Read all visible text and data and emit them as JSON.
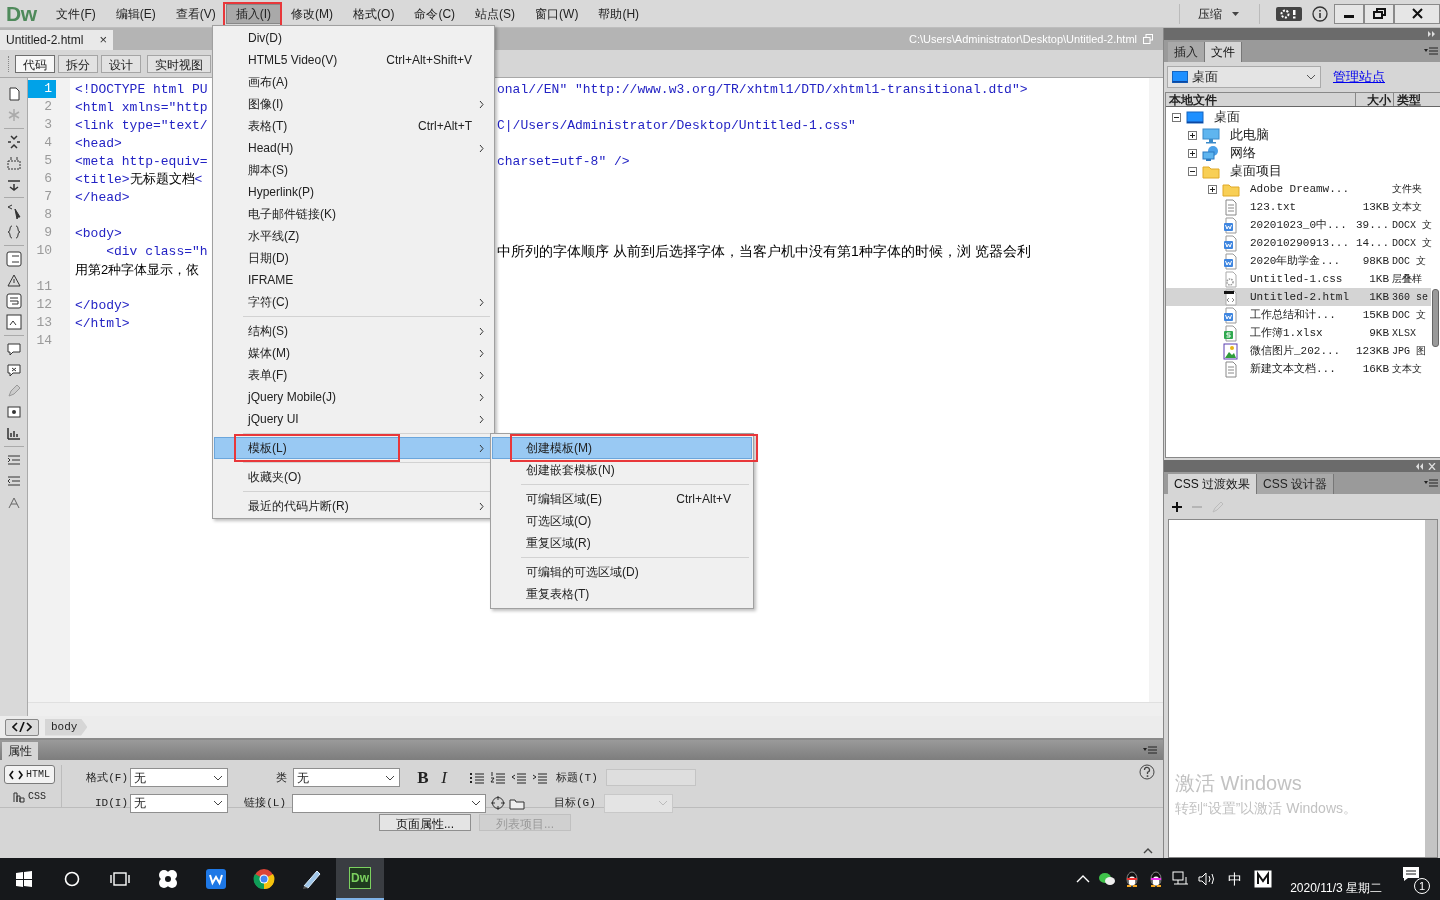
{
  "app": {
    "logo": "Dw"
  },
  "menu_bar": [
    {
      "label": "文件(F)",
      "selected": false,
      "outlined": false
    },
    {
      "label": "编辑(E)",
      "selected": false,
      "outlined": false
    },
    {
      "label": "查看(V)",
      "selected": false,
      "outlined": false
    },
    {
      "label": "插入(I)",
      "selected": true,
      "outlined": true
    },
    {
      "label": "修改(M)",
      "selected": false,
      "outlined": false
    },
    {
      "label": "格式(O)",
      "selected": false,
      "outlined": false
    },
    {
      "label": "命令(C)",
      "selected": false,
      "outlined": false
    },
    {
      "label": "站点(S)",
      "selected": false,
      "outlined": false
    },
    {
      "label": "窗口(W)",
      "selected": false,
      "outlined": false
    },
    {
      "label": "帮助(H)",
      "selected": false,
      "outlined": false
    }
  ],
  "workspace_switcher": {
    "label": "压缩"
  },
  "document_tab": {
    "title": "Untitled-2.html",
    "close": "×"
  },
  "file_path": "C:\\Users\\Administrator\\Desktop\\Untitled-2.html",
  "view_buttons": [
    {
      "label": "代码",
      "selected": true
    },
    {
      "label": "拆分",
      "selected": false
    },
    {
      "label": "设计",
      "selected": false
    },
    {
      "label": "实时视图",
      "selected": false
    }
  ],
  "code_lines": [
    {
      "number": "1",
      "selected": true,
      "left": [
        {
          "t": "<!DOCTYPE html PU",
          "kind": "tag"
        }
      ],
      "right": [
        {
          "t": "onal//EN\" \"http://www.w3.org/TR/xhtml1/DTD/xhtml1-transitional.dtd\">",
          "kind": "tag"
        }
      ]
    },
    {
      "number": "2",
      "selected": false,
      "left": [
        {
          "t": "<html xmlns=\"http",
          "kind": "tag"
        }
      ]
    },
    {
      "number": "3",
      "selected": false,
      "left": [
        {
          "t": "<link type=\"text/",
          "kind": "tag"
        }
      ],
      "right": [
        {
          "t": "C|/Users/Administrator/Desktop/Untitled-1.css\"",
          "kind": "tag"
        }
      ]
    },
    {
      "number": "4",
      "selected": false,
      "left": [
        {
          "t": "<head>",
          "kind": "tag"
        }
      ]
    },
    {
      "number": "5",
      "selected": false,
      "left": [
        {
          "t": "<meta http-equiv=",
          "kind": "tag"
        }
      ],
      "right": [
        {
          "t": "charset=utf-8\" />",
          "kind": "tag"
        }
      ]
    },
    {
      "number": "6",
      "selected": false,
      "left": [
        {
          "t": "<title>",
          "kind": "tag"
        },
        {
          "t": "无标题文档",
          "kind": "text"
        },
        {
          "t": "<",
          "kind": "tag"
        }
      ]
    },
    {
      "number": "7",
      "selected": false,
      "left": [
        {
          "t": "</head>",
          "kind": "tag"
        }
      ]
    },
    {
      "number": "8",
      "selected": false
    },
    {
      "number": "9",
      "selected": false,
      "left": [
        {
          "t": "<body>",
          "kind": "tag"
        }
      ]
    },
    {
      "number": "10",
      "selected": false,
      "left": [
        {
          "t": "    <div class=\"h",
          "kind": "tag"
        }
      ],
      "right": [
        {
          "t": "中所列的字体顺序 从前到后选择字体，当客户机中没有第1种字体的时候，浏 览器会利",
          "kind": "text"
        }
      ],
      "wrap": [
        {
          "t": "用第2种字体显示，依",
          "kind": "text"
        }
      ]
    },
    {
      "number": "11",
      "selected": false
    },
    {
      "number": "12",
      "selected": false,
      "left": [
        {
          "t": "</body>",
          "kind": "tag"
        }
      ]
    },
    {
      "number": "13",
      "selected": false,
      "left": [
        {
          "t": "</html>",
          "kind": "tag"
        }
      ]
    },
    {
      "number": "14",
      "selected": false
    }
  ],
  "insert_menu": {
    "items": [
      {
        "kind": "item",
        "label": "Div(D)",
        "submenu": false,
        "selected": false,
        "outlined": false
      },
      {
        "kind": "item",
        "label": "HTML5 Video(V)",
        "shortcut": "Ctrl+Alt+Shift+V",
        "submenu": false,
        "selected": false,
        "outlined": false
      },
      {
        "kind": "item",
        "label": "画布(A)",
        "submenu": false,
        "selected": false,
        "outlined": false
      },
      {
        "kind": "item",
        "label": "图像(I)",
        "submenu": true,
        "selected": false,
        "outlined": false
      },
      {
        "kind": "item",
        "label": "表格(T)",
        "shortcut": "Ctrl+Alt+T",
        "submenu": false,
        "selected": false,
        "outlined": false
      },
      {
        "kind": "item",
        "label": "Head(H)",
        "submenu": true,
        "selected": false,
        "outlined": false
      },
      {
        "kind": "item",
        "label": "脚本(S)",
        "submenu": false,
        "selected": false,
        "outlined": false
      },
      {
        "kind": "item",
        "label": "Hyperlink(P)",
        "submenu": false,
        "selected": false,
        "outlined": false
      },
      {
        "kind": "item",
        "label": "电子邮件链接(K)",
        "submenu": false,
        "selected": false,
        "outlined": false
      },
      {
        "kind": "item",
        "label": "水平线(Z)",
        "submenu": false,
        "selected": false,
        "outlined": false
      },
      {
        "kind": "item",
        "label": "日期(D)",
        "submenu": false,
        "selected": false,
        "outlined": false
      },
      {
        "kind": "item",
        "label": "IFRAME",
        "submenu": false,
        "selected": false,
        "outlined": false
      },
      {
        "kind": "item",
        "label": "字符(C)",
        "submenu": true,
        "selected": false,
        "outlined": false
      },
      {
        "kind": "separator"
      },
      {
        "kind": "item",
        "label": "结构(S)",
        "submenu": true,
        "selected": false,
        "outlined": false
      },
      {
        "kind": "item",
        "label": "媒体(M)",
        "submenu": true,
        "selected": false,
        "outlined": false
      },
      {
        "kind": "item",
        "label": "表单(F)",
        "submenu": true,
        "selected": false,
        "outlined": false
      },
      {
        "kind": "item",
        "label": "jQuery Mobile(J)",
        "submenu": true,
        "selected": false,
        "outlined": false
      },
      {
        "kind": "item",
        "label": "jQuery UI",
        "submenu": true,
        "selected": false,
        "outlined": false
      },
      {
        "kind": "separator"
      },
      {
        "kind": "item",
        "label": "模板(L)",
        "submenu": true,
        "selected": true,
        "outlined": true
      },
      {
        "kind": "separator"
      },
      {
        "kind": "item",
        "label": "收藏夹(O)",
        "submenu": false,
        "selected": false,
        "outlined": false
      },
      {
        "kind": "separator"
      },
      {
        "kind": "item",
        "label": "最近的代码片断(R)",
        "submenu": true,
        "selected": false,
        "outlined": false
      }
    ]
  },
  "template_submenu": {
    "items": [
      {
        "kind": "item",
        "label": "创建模板(M)",
        "submenu": false,
        "selected": true,
        "outlined": true
      },
      {
        "kind": "item",
        "label": "创建嵌套模板(N)",
        "submenu": false,
        "selected": false,
        "outlined": false
      },
      {
        "kind": "separator"
      },
      {
        "kind": "item",
        "label": "可编辑区域(E)",
        "shortcut": "Ctrl+Alt+V",
        "submenu": false,
        "selected": false,
        "outlined": false
      },
      {
        "kind": "item",
        "label": "可选区域(O)",
        "submenu": false,
        "selected": false,
        "outlined": false
      },
      {
        "kind": "item",
        "label": "重复区域(R)",
        "submenu": false,
        "selected": false,
        "outlined": false
      },
      {
        "kind": "separator"
      },
      {
        "kind": "item",
        "label": "可编辑的可选区域(D)",
        "submenu": false,
        "selected": false,
        "outlined": false
      },
      {
        "kind": "item",
        "label": "重复表格(T)",
        "submenu": false,
        "selected": false,
        "outlined": false
      }
    ]
  },
  "tag_selector": [
    "body"
  ],
  "files_panel": {
    "tabs": [
      {
        "label": "插入",
        "selected": false
      },
      {
        "label": "文件",
        "selected": true
      }
    ],
    "site": "桌面",
    "manage_link": "管理站点",
    "columns": [
      "本地文件",
      "大小",
      "类型"
    ],
    "tree": [
      {
        "label": "桌面",
        "kind": "desktop",
        "expanded": true,
        "selected": false,
        "children": [
          {
            "label": "此电脑",
            "kind": "computer",
            "expanded": false,
            "selected": false
          },
          {
            "label": "网络",
            "kind": "network",
            "expanded": false,
            "selected": false
          },
          {
            "label": "桌面项目",
            "kind": "folder",
            "expanded": true,
            "selected": false,
            "children": [
              {
                "label": "Adobe Dreamw...",
                "kind": "folder",
                "expanded": false,
                "selected": false,
                "type": "文件夹"
              },
              {
                "label": "123.txt",
                "kind": "text",
                "selected": false,
                "size": "13KB",
                "type": "文本文"
              },
              {
                "label": "20201023_0中...",
                "kind": "word",
                "selected": false,
                "size": "39...",
                "type": "DOCX 文"
              },
              {
                "label": "202010290913...",
                "kind": "word",
                "selected": false,
                "size": "14...",
                "type": "DOCX 文"
              },
              {
                "label": "2020年助学金...",
                "kind": "word",
                "selected": false,
                "size": "98KB",
                "type": "DOC 文"
              },
              {
                "label": "Untitled-1.css",
                "kind": "css",
                "selected": false,
                "size": "1KB",
                "type": "层叠样"
              },
              {
                "label": "Untitled-2.html",
                "kind": "html",
                "selected": true,
                "size": "1KB",
                "type": "360 se"
              },
              {
                "label": "工作总结和计...",
                "kind": "word",
                "selected": false,
                "size": "15KB",
                "type": "DOC 文"
              },
              {
                "label": "工作簿1.xlsx",
                "kind": "excel",
                "selected": false,
                "size": "9KB",
                "type": "XLSX"
              },
              {
                "label": "微信图片_202...",
                "kind": "image",
                "selected": false,
                "size": "123KB",
                "type": "JPG 图"
              },
              {
                "label": "新建文本文档...",
                "kind": "text",
                "selected": false,
                "size": "16KB",
                "type": "文本文"
              }
            ]
          }
        ]
      }
    ]
  },
  "css_panel": {
    "tabs": [
      {
        "label": "CSS 过渡效果",
        "selected": true
      },
      {
        "label": "CSS 设计器",
        "selected": false
      }
    ]
  },
  "activation_notice": {
    "title": "激活 Windows",
    "text": "转到“设置”以激活 Windows。"
  },
  "properties": {
    "tab": "属性",
    "modes": [
      {
        "label": "HTML",
        "selected": true
      },
      {
        "label": "CSS",
        "selected": false
      }
    ],
    "format": {
      "label": "格式(F)",
      "value": "无"
    },
    "id": {
      "label": "ID(I)",
      "value": "无"
    },
    "class": {
      "label": "类",
      "value": "无"
    },
    "link": {
      "label": "链接(L)"
    },
    "bold": "B",
    "italic": "I",
    "title": {
      "label": "标题(T)",
      "disabled": true
    },
    "target": {
      "label": "目标(G)",
      "disabled": true
    },
    "buttons": [
      {
        "label": "页面属性...",
        "disabled": false
      },
      {
        "label": "列表项目...",
        "disabled": true
      }
    ]
  },
  "taskbar": {
    "dw_label": "Dw",
    "input_method": "中",
    "date": "2020/11/3 星期二",
    "notifications": "1"
  }
}
